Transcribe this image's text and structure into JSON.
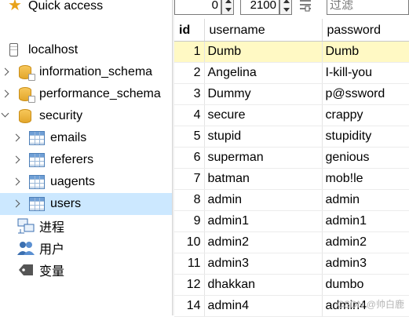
{
  "tree": {
    "quick_access": "Quick access",
    "host": "localhost",
    "databases": [
      {
        "label": "information_schema",
        "expanded": false
      },
      {
        "label": "performance_schema",
        "expanded": false
      },
      {
        "label": "security",
        "expanded": true
      }
    ],
    "tables": [
      {
        "label": "emails"
      },
      {
        "label": "referers"
      },
      {
        "label": "uagents"
      },
      {
        "label": "users",
        "selected": true
      }
    ],
    "extras": [
      {
        "label": "进程",
        "icon": "process-icon"
      },
      {
        "label": "用户",
        "icon": "users-icon"
      },
      {
        "label": "变量",
        "icon": "variables-icon"
      }
    ]
  },
  "toolbar": {
    "offset_value": "0",
    "limit_value": "2100",
    "filter_placeholder": "过滤"
  },
  "grid": {
    "columns": [
      "id",
      "username",
      "password"
    ],
    "rows": [
      {
        "id": "1",
        "username": "Dumb",
        "password": "Dumb"
      },
      {
        "id": "2",
        "username": "Angelina",
        "password": "I-kill-you"
      },
      {
        "id": "3",
        "username": "Dummy",
        "password": "p@ssword"
      },
      {
        "id": "4",
        "username": "secure",
        "password": "crappy"
      },
      {
        "id": "5",
        "username": "stupid",
        "password": "stupidity"
      },
      {
        "id": "6",
        "username": "superman",
        "password": "genious"
      },
      {
        "id": "7",
        "username": "batman",
        "password": "mob!le"
      },
      {
        "id": "8",
        "username": "admin",
        "password": "admin"
      },
      {
        "id": "9",
        "username": "admin1",
        "password": "admin1"
      },
      {
        "id": "10",
        "username": "admin2",
        "password": "admin2"
      },
      {
        "id": "11",
        "username": "admin3",
        "password": "admin3"
      },
      {
        "id": "12",
        "username": "dhakkan",
        "password": "dumbo"
      },
      {
        "id": "14",
        "username": "admin4",
        "password": "admin4"
      }
    ],
    "highlighted_row": 0
  },
  "watermark": "CSDN @帅白鹿",
  "colors": {
    "selection": "#cce8ff",
    "row_highlight": "#fff9c4",
    "db_icon": "#e3a72c",
    "star": "#e8a21a"
  }
}
